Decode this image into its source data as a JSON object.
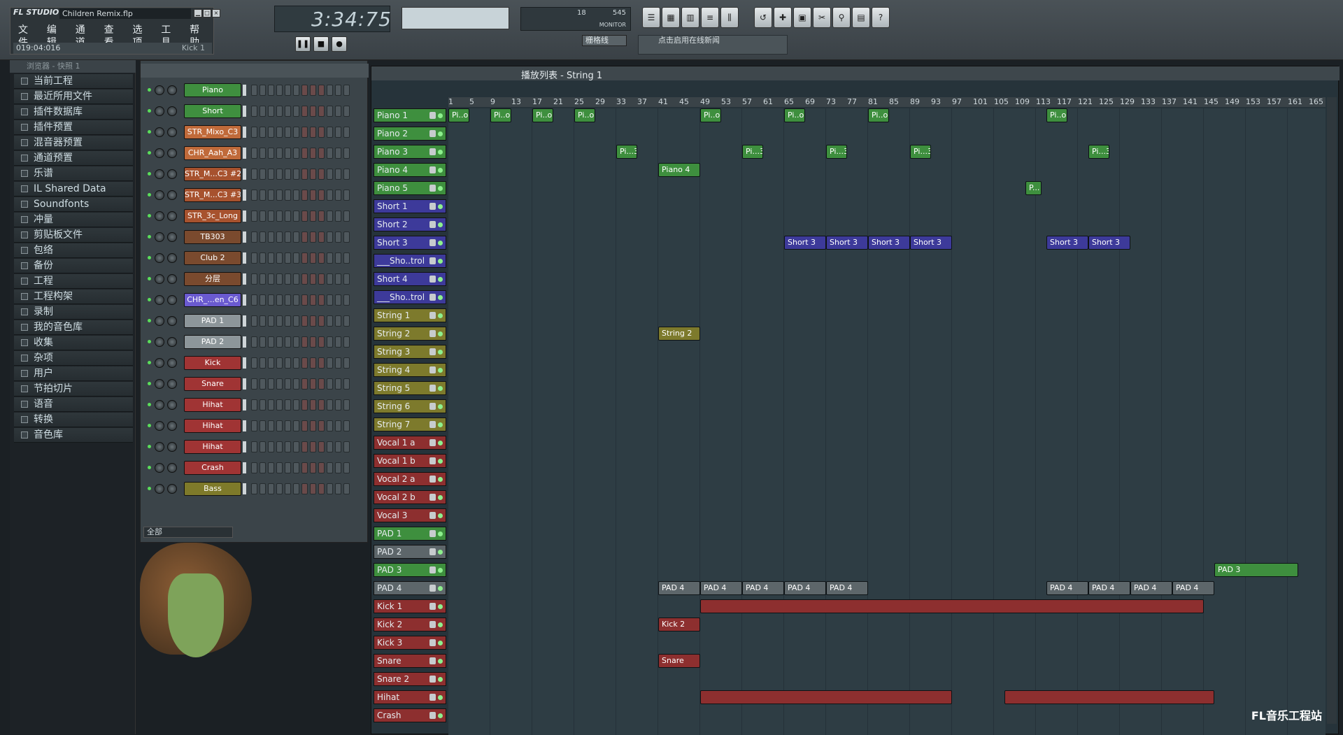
{
  "app": {
    "logo": "FL STUDIO",
    "file_name": "Children Remix.flp",
    "hint_left": "019:04:016",
    "hint_right": "Kick 1"
  },
  "menu": [
    "文件",
    "编辑",
    "通道",
    "查看",
    "选项",
    "工具",
    "帮助"
  ],
  "time": {
    "display": "3:34:75"
  },
  "monitor": {
    "cpu": "18",
    "poly": "545",
    "label": "MONITOR"
  },
  "snap": "栅格线",
  "news": "点击启用在线新闻",
  "browser": {
    "title": "浏览器 - 快照 1",
    "items": [
      "当前工程",
      "最近所用文件",
      "插件数据库",
      "插件预置",
      "混音器预置",
      "通道预置",
      "乐谱",
      "IL Shared Data",
      "Soundfonts",
      "冲量",
      "剪贴板文件",
      "包络",
      "备份",
      "工程",
      "工程构架",
      "录制",
      "我的音色库",
      "收集",
      "杂项",
      "用户",
      "节拍切片",
      "语音",
      "转换",
      "音色库"
    ]
  },
  "rack": {
    "filter": "全部",
    "channels": [
      {
        "name": "Piano",
        "color": "#3f8f3f"
      },
      {
        "name": "Short",
        "color": "#3f8f3f"
      },
      {
        "name": "STR_Mixo_C3",
        "color": "#c06a3a"
      },
      {
        "name": "CHR_Aah_A3",
        "color": "#c06a3a"
      },
      {
        "name": "STR_M...C3 #2",
        "color": "#a7522e"
      },
      {
        "name": "STR_M...C3 #3",
        "color": "#a7522e"
      },
      {
        "name": "STR_3c_Long",
        "color": "#a7522e"
      },
      {
        "name": "TB303",
        "color": "#7a4a2e"
      },
      {
        "name": "Club 2",
        "color": "#7a4a2e"
      },
      {
        "name": "分层",
        "color": "#7a4a2e"
      },
      {
        "name": "CHR_...en_C6",
        "color": "#6a5ad0"
      },
      {
        "name": "PAD 1",
        "color": "#8d969a"
      },
      {
        "name": "PAD 2",
        "color": "#8d969a"
      },
      {
        "name": "Kick",
        "color": "#a03434"
      },
      {
        "name": "Snare",
        "color": "#a03434"
      },
      {
        "name": "Hihat",
        "color": "#a03434"
      },
      {
        "name": "Hihat",
        "color": "#a03434"
      },
      {
        "name": "Hihat",
        "color": "#a03434"
      },
      {
        "name": "Crash",
        "color": "#a03434"
      },
      {
        "name": "Bass",
        "color": "#7e7a2a"
      }
    ]
  },
  "playlist": {
    "title": "播放列表 - String 1",
    "ruler": [
      "1",
      "5",
      "9",
      "13",
      "17",
      "21",
      "25",
      "29",
      "33",
      "37",
      "41",
      "45",
      "49",
      "53",
      "57",
      "61",
      "65",
      "69",
      "73",
      "77",
      "81",
      "85",
      "89",
      "93",
      "97",
      "101",
      "105",
      "109",
      "113",
      "117",
      "121",
      "125",
      "129",
      "133",
      "137",
      "141",
      "145",
      "149",
      "153",
      "157",
      "161",
      "165"
    ],
    "tracks": [
      {
        "name": "Piano 1",
        "color": "#3e8f3e"
      },
      {
        "name": "Piano 2",
        "color": "#3e8f3e"
      },
      {
        "name": "Piano 3",
        "color": "#3e8f3e"
      },
      {
        "name": "Piano 4",
        "color": "#3e8f3e"
      },
      {
        "name": "Piano 5",
        "color": "#3e8f3e"
      },
      {
        "name": "Short 1",
        "color": "#3d3a9a"
      },
      {
        "name": "Short 2",
        "color": "#3d3a9a"
      },
      {
        "name": "Short 3",
        "color": "#3d3a9a"
      },
      {
        "name": "___Sho..trol",
        "color": "#3d3a9a"
      },
      {
        "name": "Short 4",
        "color": "#3d3a9a"
      },
      {
        "name": "___Sho..trol",
        "color": "#3d3a9a"
      },
      {
        "name": "String 1",
        "color": "#7d7a2c"
      },
      {
        "name": "String 2",
        "color": "#7d7a2c"
      },
      {
        "name": "String 3",
        "color": "#7d7a2c"
      },
      {
        "name": "String 4",
        "color": "#7d7a2c"
      },
      {
        "name": "String 5",
        "color": "#7d7a2c"
      },
      {
        "name": "String 6",
        "color": "#7d7a2c"
      },
      {
        "name": "String 7",
        "color": "#7d7a2c"
      },
      {
        "name": "Vocal 1 a",
        "color": "#8d2f2f"
      },
      {
        "name": "Vocal 1 b",
        "color": "#8d2f2f"
      },
      {
        "name": "Vocal 2 a",
        "color": "#8d2f2f"
      },
      {
        "name": "Vocal 2 b",
        "color": "#8d2f2f"
      },
      {
        "name": "Vocal 3",
        "color": "#8d2f2f"
      },
      {
        "name": "PAD 1",
        "color": "#3e8f3e"
      },
      {
        "name": "PAD 2",
        "color": "#5d666a"
      },
      {
        "name": "PAD 3",
        "color": "#3e8f3e"
      },
      {
        "name": "PAD 4",
        "color": "#5d666a"
      },
      {
        "name": "Kick 1",
        "color": "#8d2f2f"
      },
      {
        "name": "Kick 2",
        "color": "#8d2f2f"
      },
      {
        "name": "Kick 3",
        "color": "#8d2f2f"
      },
      {
        "name": "Snare",
        "color": "#8d2f2f"
      },
      {
        "name": "Snare 2",
        "color": "#8d2f2f"
      },
      {
        "name": "Hihat",
        "color": "#8d2f2f"
      },
      {
        "name": "Crash",
        "color": "#8d2f2f"
      }
    ],
    "clips": [
      {
        "t": 0,
        "s": 1,
        "l": 4,
        "label": "Pi..o 1"
      },
      {
        "t": 0,
        "s": 9,
        "l": 4,
        "label": "Pi..o 1"
      },
      {
        "t": 0,
        "s": 17,
        "l": 4,
        "label": "Pi..o 1"
      },
      {
        "t": 0,
        "s": 25,
        "l": 4,
        "label": "Pi..o 1"
      },
      {
        "t": 0,
        "s": 49,
        "l": 4,
        "label": "Pi..o 1"
      },
      {
        "t": 0,
        "s": 65,
        "l": 4,
        "label": "Pi..o 1"
      },
      {
        "t": 0,
        "s": 81,
        "l": 4,
        "label": "Pi..o 1"
      },
      {
        "t": 0,
        "s": 115,
        "l": 4,
        "label": "Pi..o 1"
      },
      {
        "t": 2,
        "s": 33,
        "l": 4,
        "label": "Pi...3"
      },
      {
        "t": 2,
        "s": 57,
        "l": 4,
        "label": "Pi...3"
      },
      {
        "t": 2,
        "s": 73,
        "l": 4,
        "label": "Pi...3"
      },
      {
        "t": 2,
        "s": 89,
        "l": 4,
        "label": "Pi...3"
      },
      {
        "t": 2,
        "s": 123,
        "l": 4,
        "label": "Pi...3"
      },
      {
        "t": 3,
        "s": 41,
        "l": 8,
        "label": "Piano 4"
      },
      {
        "t": 4,
        "s": 111,
        "l": 3,
        "label": "P..."
      },
      {
        "t": 7,
        "s": 65,
        "l": 8,
        "label": "Short 3"
      },
      {
        "t": 7,
        "s": 73,
        "l": 8,
        "label": "Short 3"
      },
      {
        "t": 7,
        "s": 81,
        "l": 8,
        "label": "Short 3"
      },
      {
        "t": 7,
        "s": 89,
        "l": 8,
        "label": "Short 3"
      },
      {
        "t": 7,
        "s": 115,
        "l": 8,
        "label": "Short 3"
      },
      {
        "t": 7,
        "s": 123,
        "l": 8,
        "label": "Short 3"
      },
      {
        "t": 12,
        "s": 41,
        "l": 8,
        "label": "String 2"
      },
      {
        "t": 28,
        "s": 41,
        "l": 8,
        "label": "Kick 2"
      },
      {
        "t": 30,
        "s": 41,
        "l": 8,
        "label": "Snare"
      },
      {
        "t": 25,
        "s": 147,
        "l": 16,
        "label": "PAD 3"
      },
      {
        "t": 26,
        "s": 41,
        "l": 8,
        "label": "PAD 4"
      },
      {
        "t": 26,
        "s": 49,
        "l": 8,
        "label": "PAD 4"
      },
      {
        "t": 26,
        "s": 57,
        "l": 8,
        "label": "PAD 4"
      },
      {
        "t": 26,
        "s": 65,
        "l": 8,
        "label": "PAD 4"
      },
      {
        "t": 26,
        "s": 73,
        "l": 8,
        "label": "PAD 4"
      },
      {
        "t": 26,
        "s": 115,
        "l": 8,
        "label": "PAD 4"
      },
      {
        "t": 26,
        "s": 123,
        "l": 8,
        "label": "PAD 4"
      },
      {
        "t": 26,
        "s": 131,
        "l": 8,
        "label": "PAD 4"
      },
      {
        "t": 26,
        "s": 139,
        "l": 8,
        "label": "PAD 4"
      },
      {
        "t": 27,
        "s": 49,
        "l": 96,
        "label": ""
      },
      {
        "t": 32,
        "s": 49,
        "l": 48,
        "label": ""
      },
      {
        "t": 32,
        "s": 107,
        "l": 40,
        "label": ""
      }
    ]
  },
  "watermark": "FL音乐工程站"
}
